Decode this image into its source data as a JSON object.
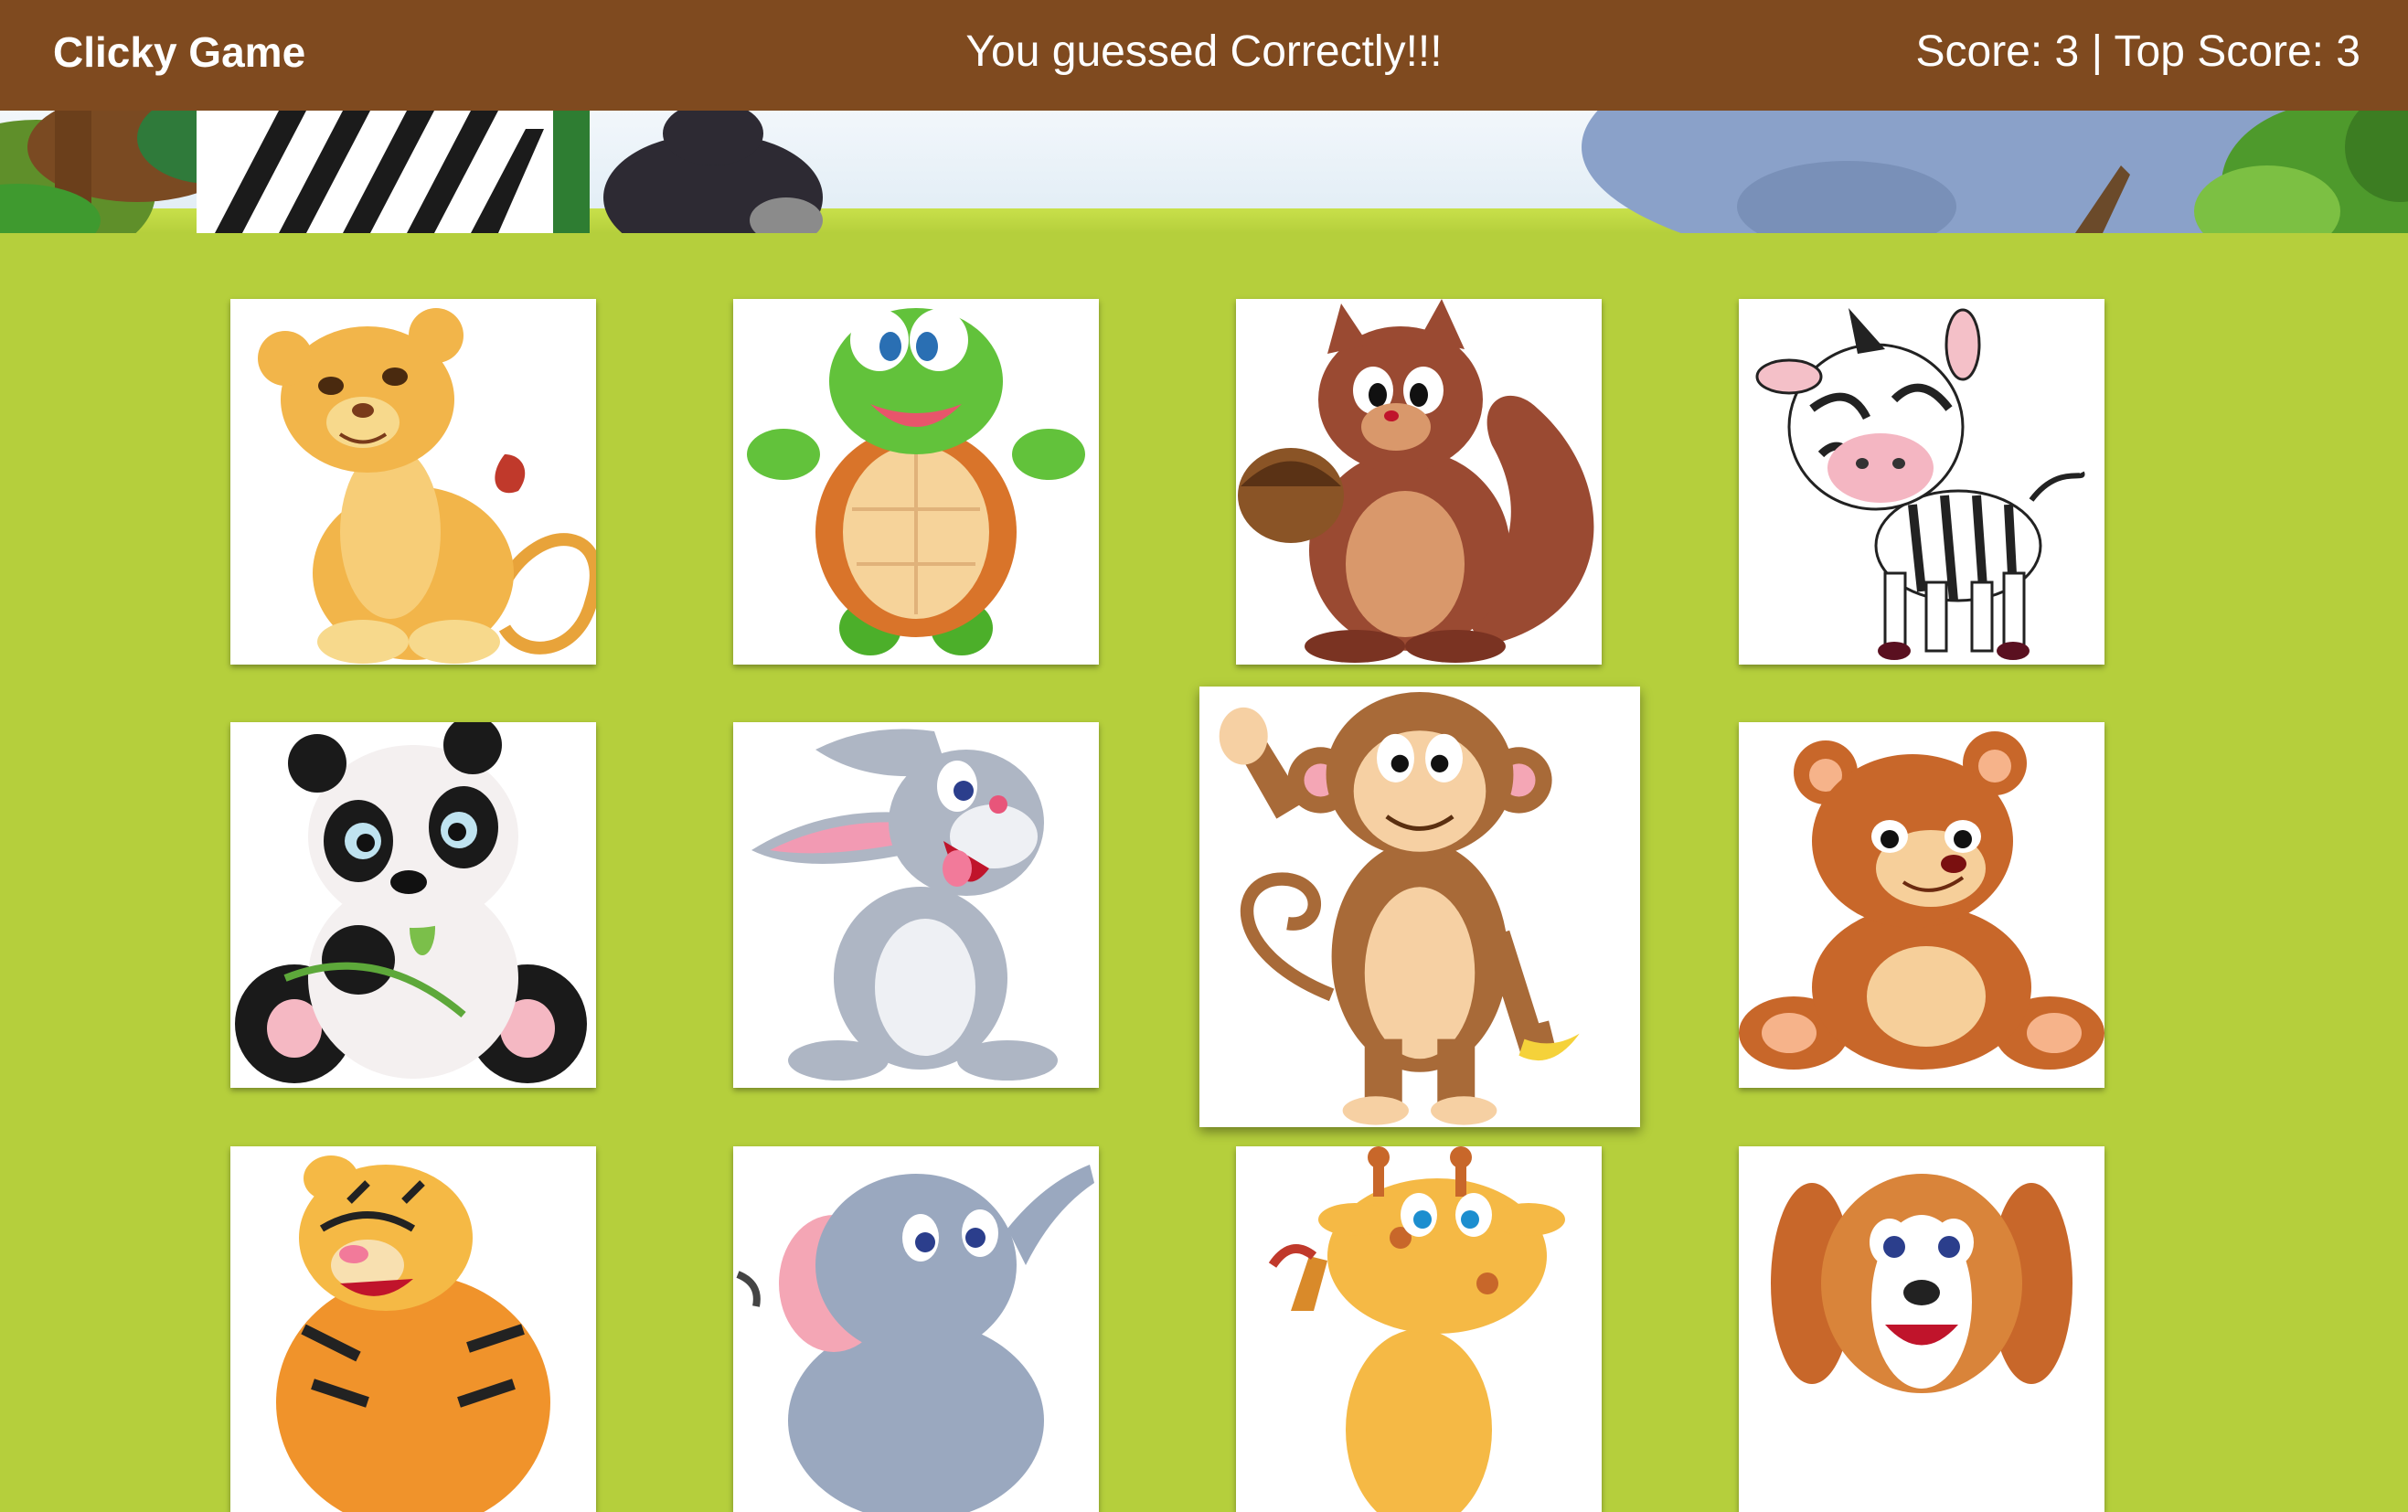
{
  "navbar": {
    "brand": "Clicky Game",
    "message": "You guessed Correctly!!!",
    "score_text": "Score: 3 | Top Score: 3"
  },
  "game": {
    "score": 3,
    "top_score": 3
  },
  "colors": {
    "navbar": "#7f4a1f",
    "page_background": "#b5cf3c",
    "card_background": "#ffffff"
  },
  "cards": [
    {
      "animal": "lion-cub",
      "icon": "lion-icon"
    },
    {
      "animal": "turtle",
      "icon": "turtle-icon"
    },
    {
      "animal": "squirrel",
      "icon": "squirrel-icon"
    },
    {
      "animal": "zebra",
      "icon": "zebra-icon"
    },
    {
      "animal": "panda",
      "icon": "panda-icon"
    },
    {
      "animal": "bunny",
      "icon": "bunny-icon"
    },
    {
      "animal": "monkey",
      "icon": "monkey-icon"
    },
    {
      "animal": "bear",
      "icon": "bear-icon"
    },
    {
      "animal": "tiger",
      "icon": "tiger-icon"
    },
    {
      "animal": "elephant",
      "icon": "elephant-icon"
    },
    {
      "animal": "giraffe",
      "icon": "giraffe-icon"
    },
    {
      "animal": "puppy",
      "icon": "puppy-icon"
    }
  ]
}
